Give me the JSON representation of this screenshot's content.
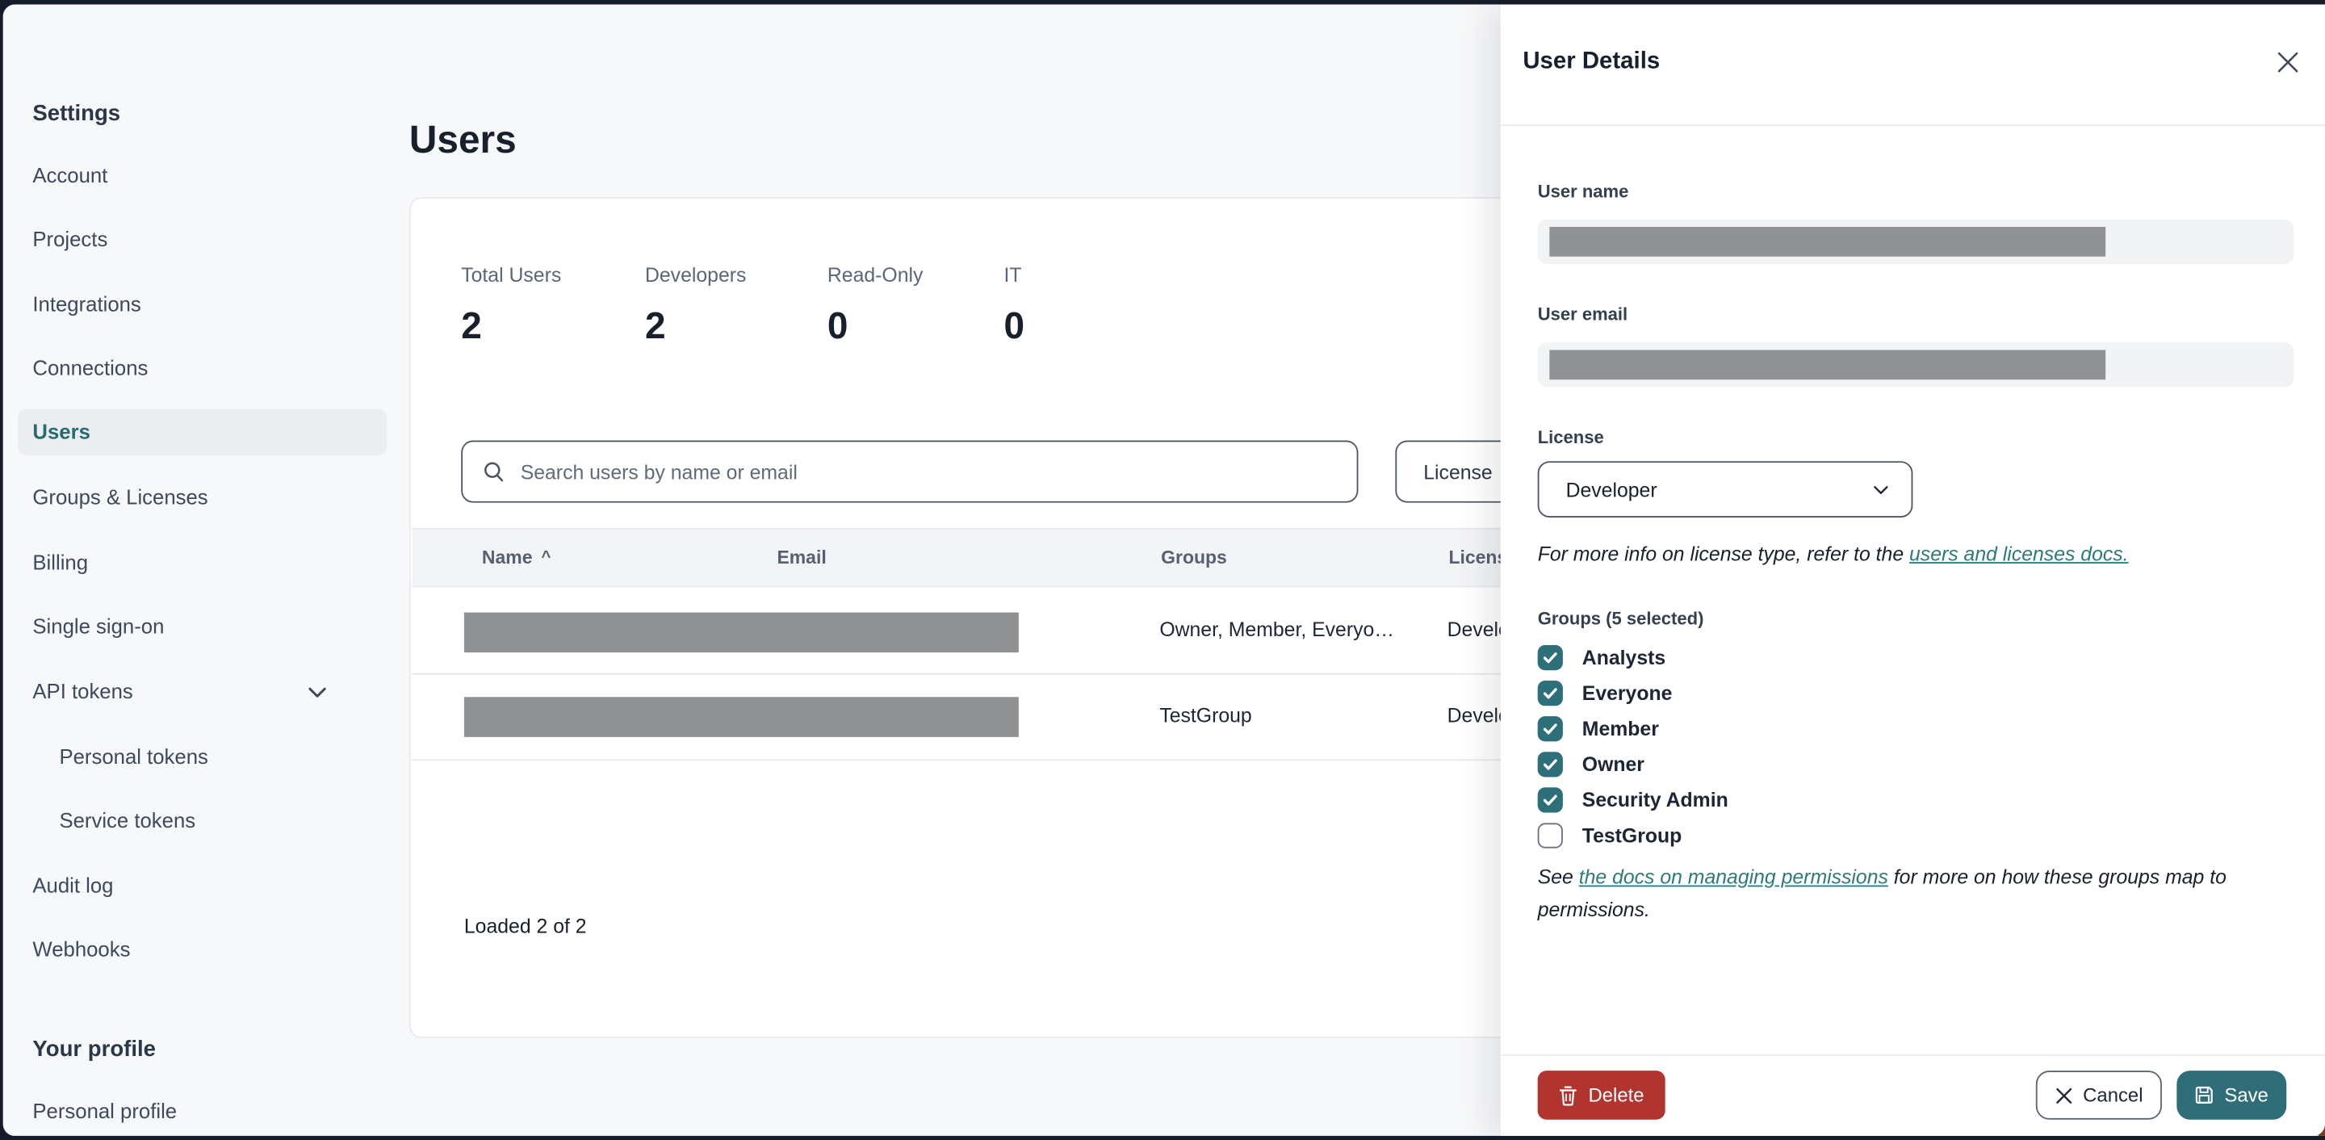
{
  "colors": {
    "accent_teal": "#2e707a",
    "link_teal": "#2c7a7b",
    "delete_red": "#b2342f",
    "save_teal": "#2f6e79",
    "active_nav_teal": "#276b6e",
    "redaction_gray": "#909193",
    "frame_dark": "#151b28"
  },
  "icons": {
    "search": "magnifier",
    "chevron_down": "chevron-down",
    "close": "x",
    "sort": "caret-up",
    "delete": "trash",
    "cancel": "x",
    "save": "floppy-disk"
  },
  "sidebar": {
    "heading": "Settings",
    "items": [
      {
        "label": "Account"
      },
      {
        "label": "Projects"
      },
      {
        "label": "Integrations"
      },
      {
        "label": "Connections"
      },
      {
        "label": "Users",
        "active": true
      },
      {
        "label": "Groups & Licenses"
      },
      {
        "label": "Billing"
      },
      {
        "label": "Single sign-on"
      },
      {
        "label": "API tokens",
        "has_chevron": true
      },
      {
        "label": "Personal tokens",
        "indent": true
      },
      {
        "label": "Service tokens",
        "indent": true
      },
      {
        "label": "Audit log"
      },
      {
        "label": "Webhooks"
      }
    ],
    "profile_heading": "Your profile",
    "profile_items": [
      {
        "label": "Personal profile"
      }
    ]
  },
  "main": {
    "title": "Users",
    "stats": [
      {
        "label": "Total Users",
        "value": "2"
      },
      {
        "label": "Developers",
        "value": "2"
      },
      {
        "label": "Read-Only",
        "value": "0"
      },
      {
        "label": "IT",
        "value": "0"
      }
    ],
    "search_placeholder": "Search users by name or email",
    "filter_label": "License",
    "table": {
      "headers": {
        "name": "Name",
        "email": "Email",
        "groups": "Groups",
        "license": "License"
      },
      "sort_caret": "^",
      "rows": [
        {
          "name_redacted": true,
          "groups": "Owner, Member, Everyo…",
          "license": "Developer"
        },
        {
          "name_redacted": true,
          "groups": "TestGroup",
          "license": "Developer"
        }
      ]
    },
    "footer_status": "Loaded 2 of 2"
  },
  "panel": {
    "title": "User Details",
    "user_name_label": "User name",
    "user_email_label": "User email",
    "license_label": "License",
    "license_value": "Developer",
    "license_note_prefix": "For more info on license type, refer to the ",
    "license_note_link": "users and licenses docs.",
    "groups": {
      "heading": "Groups (5 selected)",
      "items": [
        {
          "label": "Analysts",
          "checked": true
        },
        {
          "label": "Everyone",
          "checked": true
        },
        {
          "label": "Member",
          "checked": true
        },
        {
          "label": "Owner",
          "checked": true
        },
        {
          "label": "Security Admin",
          "checked": true
        },
        {
          "label": "TestGroup",
          "checked": false
        }
      ]
    },
    "permissions_note_prefix": "See ",
    "permissions_note_link": "the docs on managing permissions",
    "permissions_note_suffix": " for more on how these groups map to permissions.",
    "buttons": {
      "delete": "Delete",
      "cancel": "Cancel",
      "save": "Save"
    }
  }
}
